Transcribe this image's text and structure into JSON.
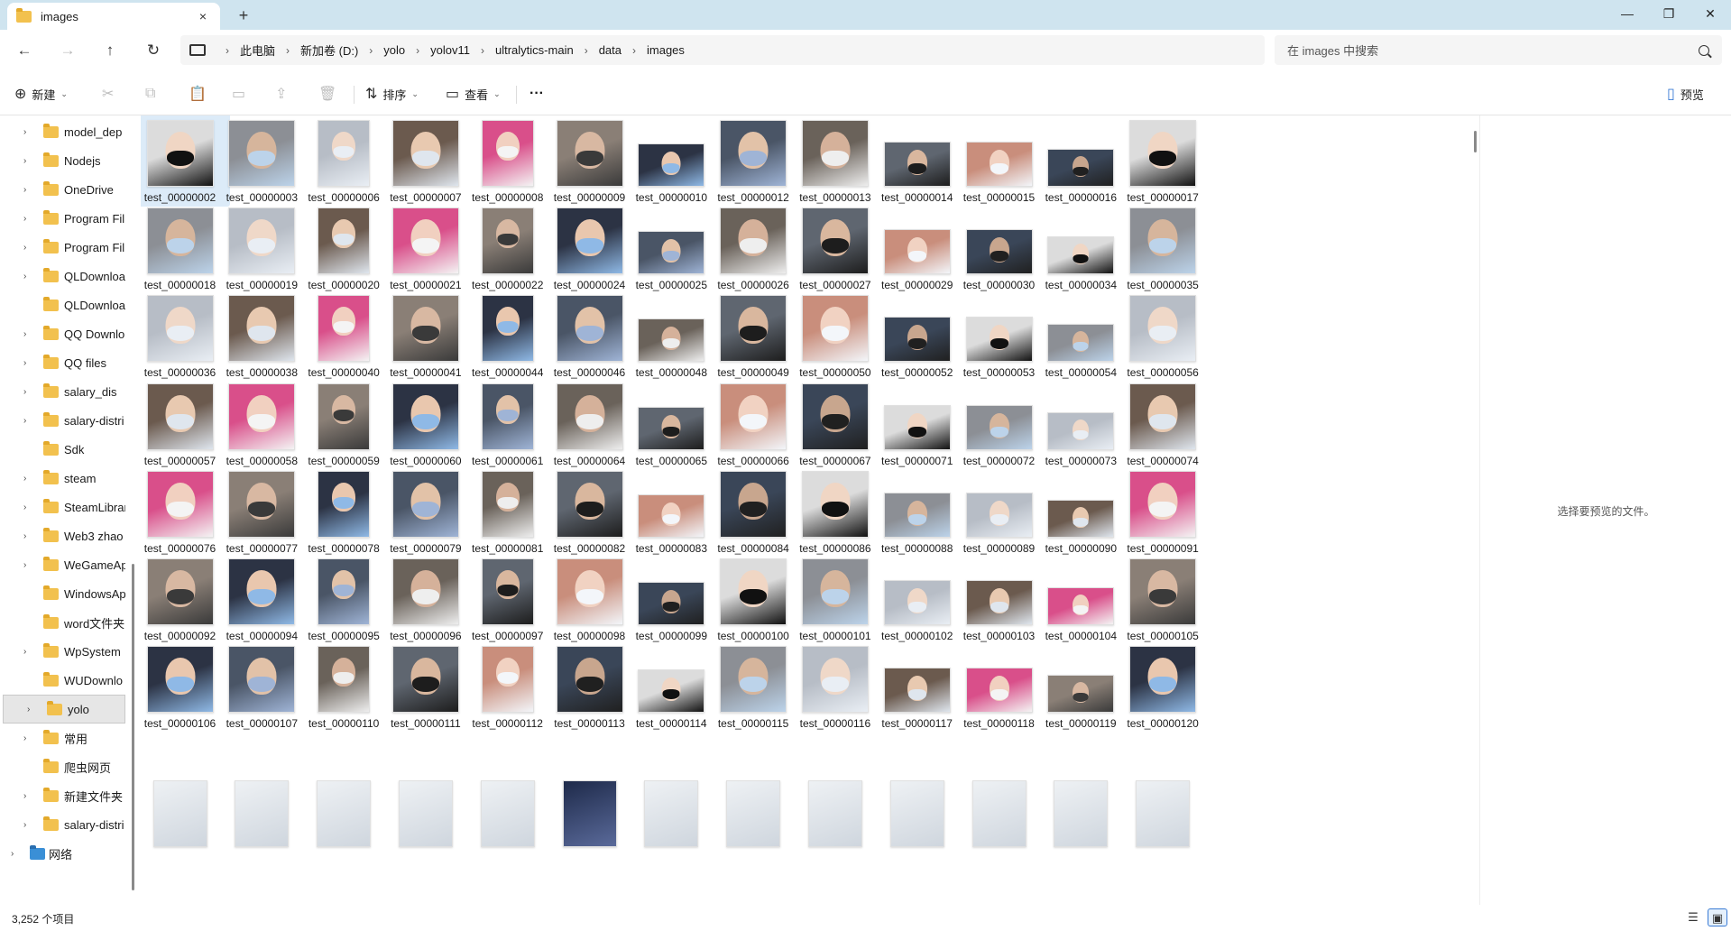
{
  "window": {
    "tab_title": "images",
    "tab_close_icon": "×",
    "new_tab_icon": "+",
    "minimize_icon": "—",
    "maximize_icon": "❐",
    "close_icon": "✕"
  },
  "nav": {
    "back_icon": "←",
    "forward_icon": "→",
    "up_icon": "↑",
    "refresh_icon": "↻",
    "breadcrumbs": [
      "此电脑",
      "新加卷 (D:)",
      "yolo",
      "yolov11",
      "ultralytics-main",
      "data",
      "images"
    ],
    "separator": "›",
    "search_placeholder": "在 images 中搜索"
  },
  "toolbar": {
    "new_label": "新建",
    "new_icon": "⊕",
    "cut_icon": "✂",
    "copy_icon": "⧉",
    "paste_icon": "📋",
    "rename_icon": "▭",
    "share_icon": "⇪",
    "delete_icon": "🗑",
    "sort_label": "排序",
    "sort_icon": "⇅",
    "view_label": "查看",
    "view_icon": "▭",
    "more_label": "···",
    "details_label": "预览",
    "details_icon": "▯"
  },
  "sidebar": {
    "items": [
      {
        "label": "model_dep",
        "arrow": "›"
      },
      {
        "label": "Nodejs",
        "arrow": "›"
      },
      {
        "label": "OneDrive",
        "arrow": "›"
      },
      {
        "label": "Program Fil",
        "arrow": "›"
      },
      {
        "label": "Program Fil",
        "arrow": "›"
      },
      {
        "label": "QLDownloa",
        "arrow": "›"
      },
      {
        "label": "QLDownloa",
        "arrow": ""
      },
      {
        "label": "QQ Downlo",
        "arrow": "›"
      },
      {
        "label": "QQ files",
        "arrow": "›"
      },
      {
        "label": "salary_dis",
        "arrow": "›"
      },
      {
        "label": "salary-distri",
        "arrow": "›"
      },
      {
        "label": "Sdk",
        "arrow": ""
      },
      {
        "label": "steam",
        "arrow": "›"
      },
      {
        "label": "SteamLibrar",
        "arrow": "›"
      },
      {
        "label": "Web3 zhao",
        "arrow": "›"
      },
      {
        "label": "WeGameAp",
        "arrow": "›"
      },
      {
        "label": "WindowsAp",
        "arrow": ""
      },
      {
        "label": "word文件夹",
        "arrow": ""
      },
      {
        "label": "WpSystem",
        "arrow": "›"
      },
      {
        "label": "WUDownlo",
        "arrow": ""
      },
      {
        "label": "yolo",
        "arrow": "›"
      },
      {
        "label": "常用",
        "arrow": "›"
      },
      {
        "label": "爬虫网页",
        "arrow": ""
      },
      {
        "label": "新建文件夹",
        "arrow": "›"
      },
      {
        "label": "salary-distri",
        "arrow": "›"
      }
    ],
    "network": {
      "label": "网络",
      "arrow": "›"
    }
  },
  "files": [
    "test_00000002",
    "test_00000003",
    "test_00000006",
    "test_00000007",
    "test_00000008",
    "test_00000009",
    "test_00000010",
    "test_00000012",
    "test_00000013",
    "test_00000014",
    "test_00000015",
    "test_00000016",
    "test_00000017",
    "test_00000018",
    "test_00000019",
    "test_00000020",
    "test_00000021",
    "test_00000022",
    "test_00000024",
    "test_00000025",
    "test_00000026",
    "test_00000027",
    "test_00000029",
    "test_00000030",
    "test_00000034",
    "test_00000035",
    "test_00000036",
    "test_00000038",
    "test_00000040",
    "test_00000041",
    "test_00000044",
    "test_00000046",
    "test_00000048",
    "test_00000049",
    "test_00000050",
    "test_00000052",
    "test_00000053",
    "test_00000054",
    "test_00000056",
    "test_00000057",
    "test_00000058",
    "test_00000059",
    "test_00000060",
    "test_00000061",
    "test_00000064",
    "test_00000065",
    "test_00000066",
    "test_00000067",
    "test_00000071",
    "test_00000072",
    "test_00000073",
    "test_00000074",
    "test_00000076",
    "test_00000077",
    "test_00000078",
    "test_00000079",
    "test_00000081",
    "test_00000082",
    "test_00000083",
    "test_00000084",
    "test_00000086",
    "test_00000088",
    "test_00000089",
    "test_00000090",
    "test_00000091",
    "test_00000092",
    "test_00000094",
    "test_00000095",
    "test_00000096",
    "test_00000097",
    "test_00000098",
    "test_00000099",
    "test_00000100",
    "test_00000101",
    "test_00000102",
    "test_00000103",
    "test_00000104",
    "test_00000105",
    "test_00000106",
    "test_00000107",
    "test_00000110",
    "test_00000111",
    "test_00000112",
    "test_00000113",
    "test_00000114",
    "test_00000115",
    "test_00000116",
    "test_00000117",
    "test_00000118",
    "test_00000119",
    "test_00000120"
  ],
  "preview": {
    "message": "选择要预览的文件。"
  },
  "status": {
    "item_count": "3,252 个项目",
    "details_view_icon": "☰",
    "thumbnail_view_icon": "▣"
  },
  "colors": {
    "title_bar": "#cfe4ef",
    "folder": "#f2c14e",
    "selection": "#dcebf8",
    "accent": "#3a7bd5"
  }
}
